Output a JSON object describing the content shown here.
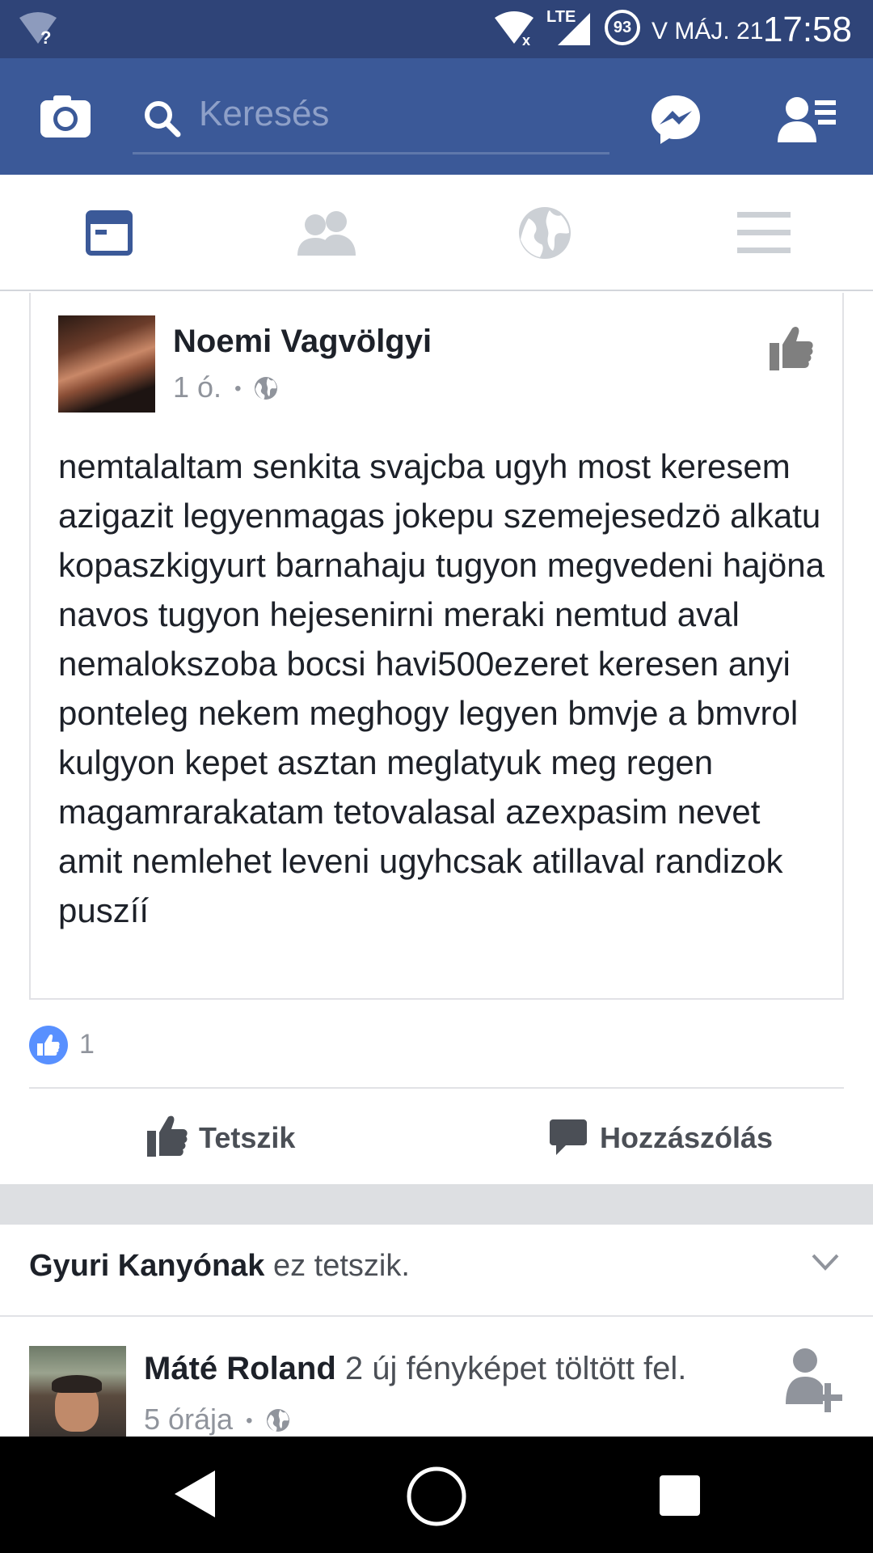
{
  "status_bar": {
    "date": "V MÁJ. 21",
    "time": "17:58",
    "battery": "93",
    "network": "LTE"
  },
  "header": {
    "search_placeholder": "Keresés",
    "icons": [
      "camera-icon",
      "search-icon",
      "messenger-icon",
      "friend-requests-icon"
    ]
  },
  "tabs": [
    "news-feed-icon",
    "friends-icon",
    "globe-icon",
    "menu-icon"
  ],
  "post": {
    "author": "Noemi Vagvölgyi",
    "time": "1 ó.",
    "separator": "•",
    "text": "nemtalaltam senkita svajcba ugyh most keresem azigazit legyenmagas jokepu szemejesedzö alkatu kopaszkigyurt barnahaju tugyon megvedeni hajöna navos tugyon hejesenirni meraki nemtud aval nemalokszoba bocsi havi500ezeret keresen anyi ponteleg nekem meghogy legyen bmvje a bmvrol kulgyon kepet asztan meglatyuk meg regen magamrarakatam tetovalasal azexpasim nevet amit nemlehet leveni ugyhcsak atillaval randizok puszíí",
    "like_count": "1",
    "like_label": "Tetszik",
    "comment_label": "Hozzászólás"
  },
  "liked_notice": {
    "name": "Gyuri Kanyónak",
    "rest": "ez tetszik."
  },
  "next_post": {
    "author": "Máté Roland",
    "action": "2 új fényképet töltött fel.",
    "time": "5 órája",
    "separator": "•"
  },
  "colors": {
    "facebook_blue": "#3b5998",
    "status_bar": "#2f4478",
    "like_blue": "#5890ff"
  }
}
